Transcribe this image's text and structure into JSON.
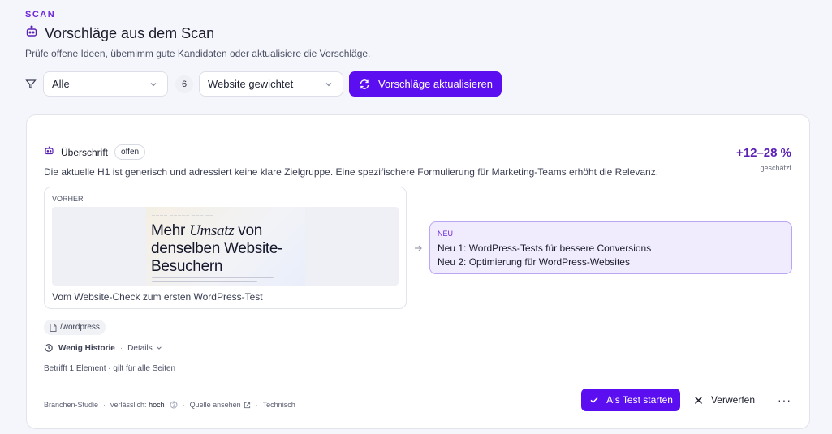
{
  "header": {
    "eyebrow": "SCAN",
    "title": "Vorschläge aus dem Scan",
    "subtitle": "Prüfe offene Ideen, übemimm gute Kandidaten oder aktualisiere die Vorschläge."
  },
  "filters": {
    "status_value": "Alle",
    "count": "6",
    "weighting_value": "Website gewichtet",
    "refresh_label": "Vorschläge aktualisieren"
  },
  "suggestion": {
    "label": "Überschrift",
    "status": "offen",
    "impact": "+12–28 %",
    "impact_note": "geschätzt",
    "description": "Die aktuelle H1 ist generisch und adressiert keine klare Zielgruppe. Eine spezifischere Formulierung für Marketing-Teams erhöht die Relevanz.",
    "before": {
      "caption": "VORHER",
      "preview_h_part1": "Mehr ",
      "preview_h_em": "Umsatz",
      "preview_h_part2": " von denselben Website-Besuchern",
      "text": "Vom Website-Check zum ersten WordPress-Test"
    },
    "after": {
      "caption": "NEU",
      "line1": "Neu 1: WordPress-Tests für bessere Conversions",
      "line2": "Neu 2: Optimierung für WordPress-Websites"
    },
    "path": "/wordpress",
    "history_label": "Wenig Historie",
    "details_label": "Details",
    "affects": "Betrifft 1 Element · gilt für alle Seiten",
    "meta": {
      "source_type": "Branchen-Studie",
      "reliability_label": "verlässlich:",
      "reliability_value": "hoch",
      "source_link": "Quelle ansehen",
      "category": "Technisch"
    },
    "actions": {
      "start_label": "Als Test starten",
      "dismiss_label": "Verwerfen",
      "more_label": "···"
    }
  },
  "colors": {
    "accent": "#5b0ff0",
    "eyebrow": "#6d28d9",
    "impact": "#5b21b6",
    "new_box_bg": "#f0ecfd",
    "new_box_border": "#b9a6f5"
  }
}
